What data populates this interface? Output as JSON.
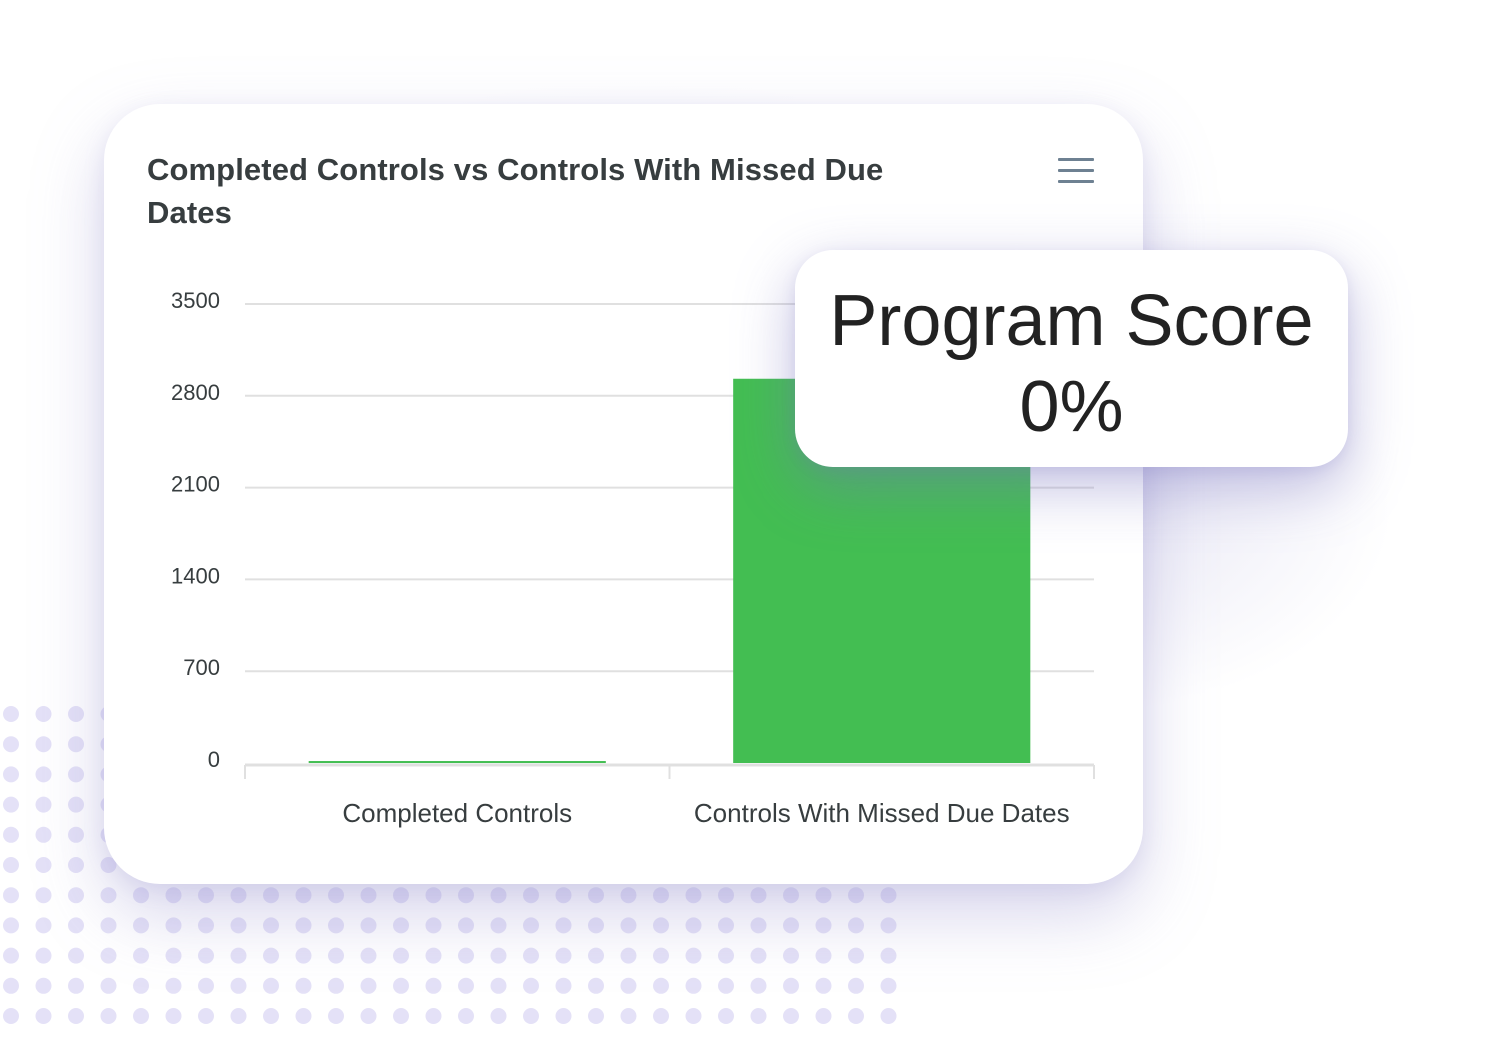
{
  "chart_data": {
    "type": "bar",
    "title": "Completed Controls vs Controls With Missed Due Dates",
    "categories": [
      "Completed Controls",
      "Controls With Missed Due Dates"
    ],
    "values": [
      15,
      2930
    ],
    "xlabel": "",
    "ylabel": "",
    "ylim": [
      0,
      3500
    ],
    "yticks": [
      0,
      700,
      1400,
      2100,
      2800,
      3500
    ],
    "grid": true,
    "legend": "none",
    "bar_color": "#43be52"
  },
  "card": {
    "title": "Completed Controls vs Controls With Missed Due Dates",
    "menu_icon": "hamburger-menu-icon"
  },
  "score": {
    "label": "Program Score",
    "value": "0%"
  },
  "colors": {
    "bar": "#43be52",
    "text": "#373d3f",
    "grid": "#e0e0e0",
    "menu_icon": "#6e8192",
    "dots": "#e4e1f7"
  }
}
